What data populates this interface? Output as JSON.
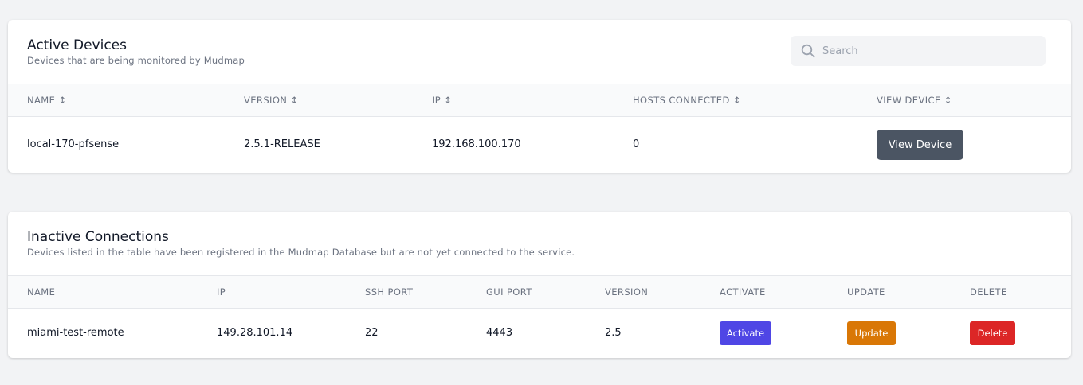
{
  "active": {
    "title": "Active Devices",
    "subtitle": "Devices that are being monitored by Mudmap",
    "search_placeholder": "Search",
    "columns": [
      "NAME ↕",
      "VERSION ↕",
      "IP ↕",
      "HOSTS CONNECTED ↕",
      "VIEW DEVICE ↕"
    ],
    "rows": [
      {
        "name": "local-170-pfsense",
        "version": "2.5.1-RELEASE",
        "ip": "192.168.100.170",
        "hosts_connected": "0",
        "view_label": "View Device"
      }
    ]
  },
  "inactive": {
    "title": "Inactive Connections",
    "subtitle": "Devices listed in the table have been registered in the Mudmap Database but are not yet connected to the service.",
    "columns": [
      "NAME",
      "IP",
      "SSH PORT",
      "GUI PORT",
      "VERSION",
      "ACTIVATE",
      "UPDATE",
      "DELETE"
    ],
    "rows": [
      {
        "name": "miami-test-remote",
        "ip": "149.28.101.14",
        "ssh_port": "22",
        "gui_port": "4443",
        "version": "2.5",
        "activate_label": "Activate",
        "update_label": "Update",
        "delete_label": "Delete"
      }
    ]
  },
  "colors": {
    "view_button": "#4b5563",
    "activate": "#4f46e5",
    "update": "#d97706",
    "delete": "#dc2626"
  },
  "icons": {
    "search": "search-icon"
  }
}
